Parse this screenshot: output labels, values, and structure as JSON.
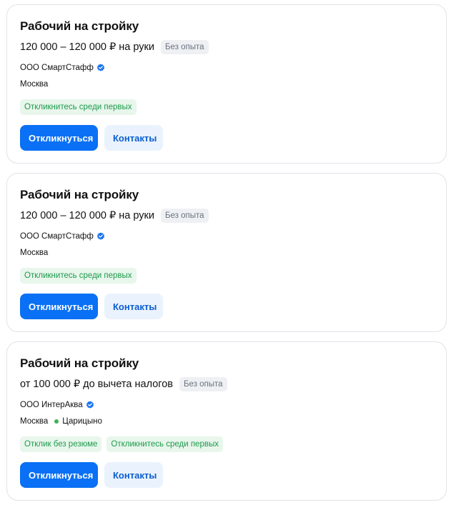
{
  "colors": {
    "primary": "#0a70f5",
    "verified": "#1a73f0",
    "tag_bg": "#e8f6ec",
    "tag_text": "#1c9b4a",
    "metro_line": "#3db158"
  },
  "vacancies": [
    {
      "title": "Рабочий на стройку",
      "salary": "120 000 – 120 000 ₽ на руки",
      "experience": "Без опыта",
      "company": "ООО СмартСтафф",
      "company_verified_icon": "verified-check-icon",
      "city": "Москва",
      "tags": [
        "Откликнитесь среди первых"
      ],
      "apply_label": "Откликнуться",
      "contacts_label": "Контакты"
    },
    {
      "title": "Рабочий на стройку",
      "salary": "120 000 – 120 000 ₽ на руки",
      "experience": "Без опыта",
      "company": "ООО СмартСтафф",
      "company_verified_icon": "verified-check-icon",
      "city": "Москва",
      "tags": [
        "Откликнитесь среди первых"
      ],
      "apply_label": "Откликнуться",
      "contacts_label": "Контакты"
    },
    {
      "title": "Рабочий на стройку",
      "salary": "от 100 000 ₽ до вычета налогов",
      "experience": "Без опыта",
      "company": "ООО ИнтерАква",
      "company_verified_icon": "verified-check-icon",
      "city": "Москва",
      "metro": "Царицыно",
      "tags": [
        "Отклик без резюме",
        "Откликнитесь среди первых"
      ],
      "apply_label": "Откликнуться",
      "contacts_label": "Контакты"
    }
  ]
}
